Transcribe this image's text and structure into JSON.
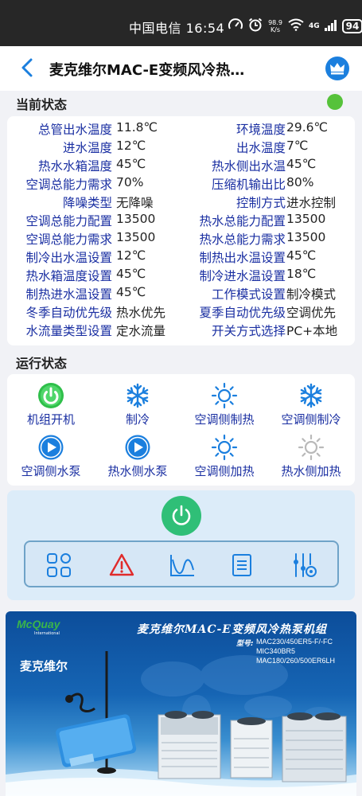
{
  "status_bar": {
    "carrier_time": "中国电信 16:54",
    "speed_value": "98.9",
    "speed_unit": "K/s",
    "network": "4G",
    "battery": "94"
  },
  "header": {
    "title": "麦克维尔MAC-E变频风冷热…",
    "back_icon": "chevron-left-icon",
    "vip_icon": "crown-icon"
  },
  "current_status": {
    "title": "当前状态",
    "indicator_color": "#56c23a",
    "rows": [
      {
        "l1": "总管出水温度",
        "v1": "11.8℃",
        "l2": "环境温度",
        "v2": "29.6℃"
      },
      {
        "l1": "进水温度",
        "v1": "12℃",
        "l2": "出水温度",
        "v2": "7℃"
      },
      {
        "l1": "热水水箱温度",
        "v1": "45℃",
        "l2": "热水侧出水温",
        "v2": "45℃"
      },
      {
        "l1": "空调总能力需求",
        "v1": "70%",
        "l2": "压缩机输出比",
        "v2": "80%"
      },
      {
        "l1": "降噪类型",
        "v1": "无降噪",
        "l2": "控制方式",
        "v2": "进水控制"
      },
      {
        "l1": "空调总能力配置",
        "v1": "13500",
        "l2": "热水总能力配置",
        "v2": "13500"
      },
      {
        "l1": "空调总能力需求",
        "v1": "13500",
        "l2": "热水总能力需求",
        "v2": "13500"
      },
      {
        "l1": "制冷出水温设置",
        "v1": "12℃",
        "l2": "制热出水温设置",
        "v2": "45℃"
      },
      {
        "l1": "热水箱温度设置",
        "v1": "45℃",
        "l2": "制冷进水温设置",
        "v2": "18℃"
      },
      {
        "l1": "制热进水温设置",
        "v1": "45℃",
        "l2": "工作模式设置",
        "v2": "制冷模式"
      },
      {
        "l1": "冬季自动优先级",
        "v1": "热水优先",
        "l2": "夏季自动优先级",
        "v2": "空调优先"
      },
      {
        "l1": "水流量类型设置",
        "v1": "定水流量",
        "l2": "开关方式选择",
        "v2": "PC+本地"
      }
    ]
  },
  "run_status": {
    "title": "运行状态",
    "items": [
      {
        "label": "机组开机",
        "icon": "power-on-icon",
        "active": true
      },
      {
        "label": "制冷",
        "icon": "snowflake-icon",
        "active": true
      },
      {
        "label": "空调侧制热",
        "icon": "sun-icon",
        "active": true
      },
      {
        "label": "空调侧制冷",
        "icon": "snowflake-icon",
        "active": true
      },
      {
        "label": "空调侧水泵",
        "icon": "pump-play-icon",
        "active": true
      },
      {
        "label": "热水侧水泵",
        "icon": "pump-play-icon",
        "active": true
      },
      {
        "label": "空调侧加热",
        "icon": "sun-icon",
        "active": true
      },
      {
        "label": "热水侧加热",
        "icon": "sun-icon",
        "active": false
      }
    ]
  },
  "controls": {
    "power_icon": "power-icon",
    "power_color": "#2fbf77",
    "tools": [
      "grid-menu-icon",
      "alarm-warning-icon",
      "trend-chart-icon",
      "document-list-icon",
      "slider-settings-icon"
    ]
  },
  "banner": {
    "brand_en": "McQuay",
    "brand_sub": "International",
    "brand_cn": "麦克维尔",
    "title": "麦克维尔MAC-E变频风冷热泵机组",
    "model_label": "型号:",
    "models": [
      "MAC230/450ER5-F/-FC",
      "MIC340BR5",
      "MAC180/260/500ER6LH"
    ]
  },
  "colors": {
    "label_blue": "#1a2fa2",
    "icon_blue": "#1b7fde",
    "alarm_red": "#e02b2b",
    "panel_bg": "#dcecf9"
  }
}
